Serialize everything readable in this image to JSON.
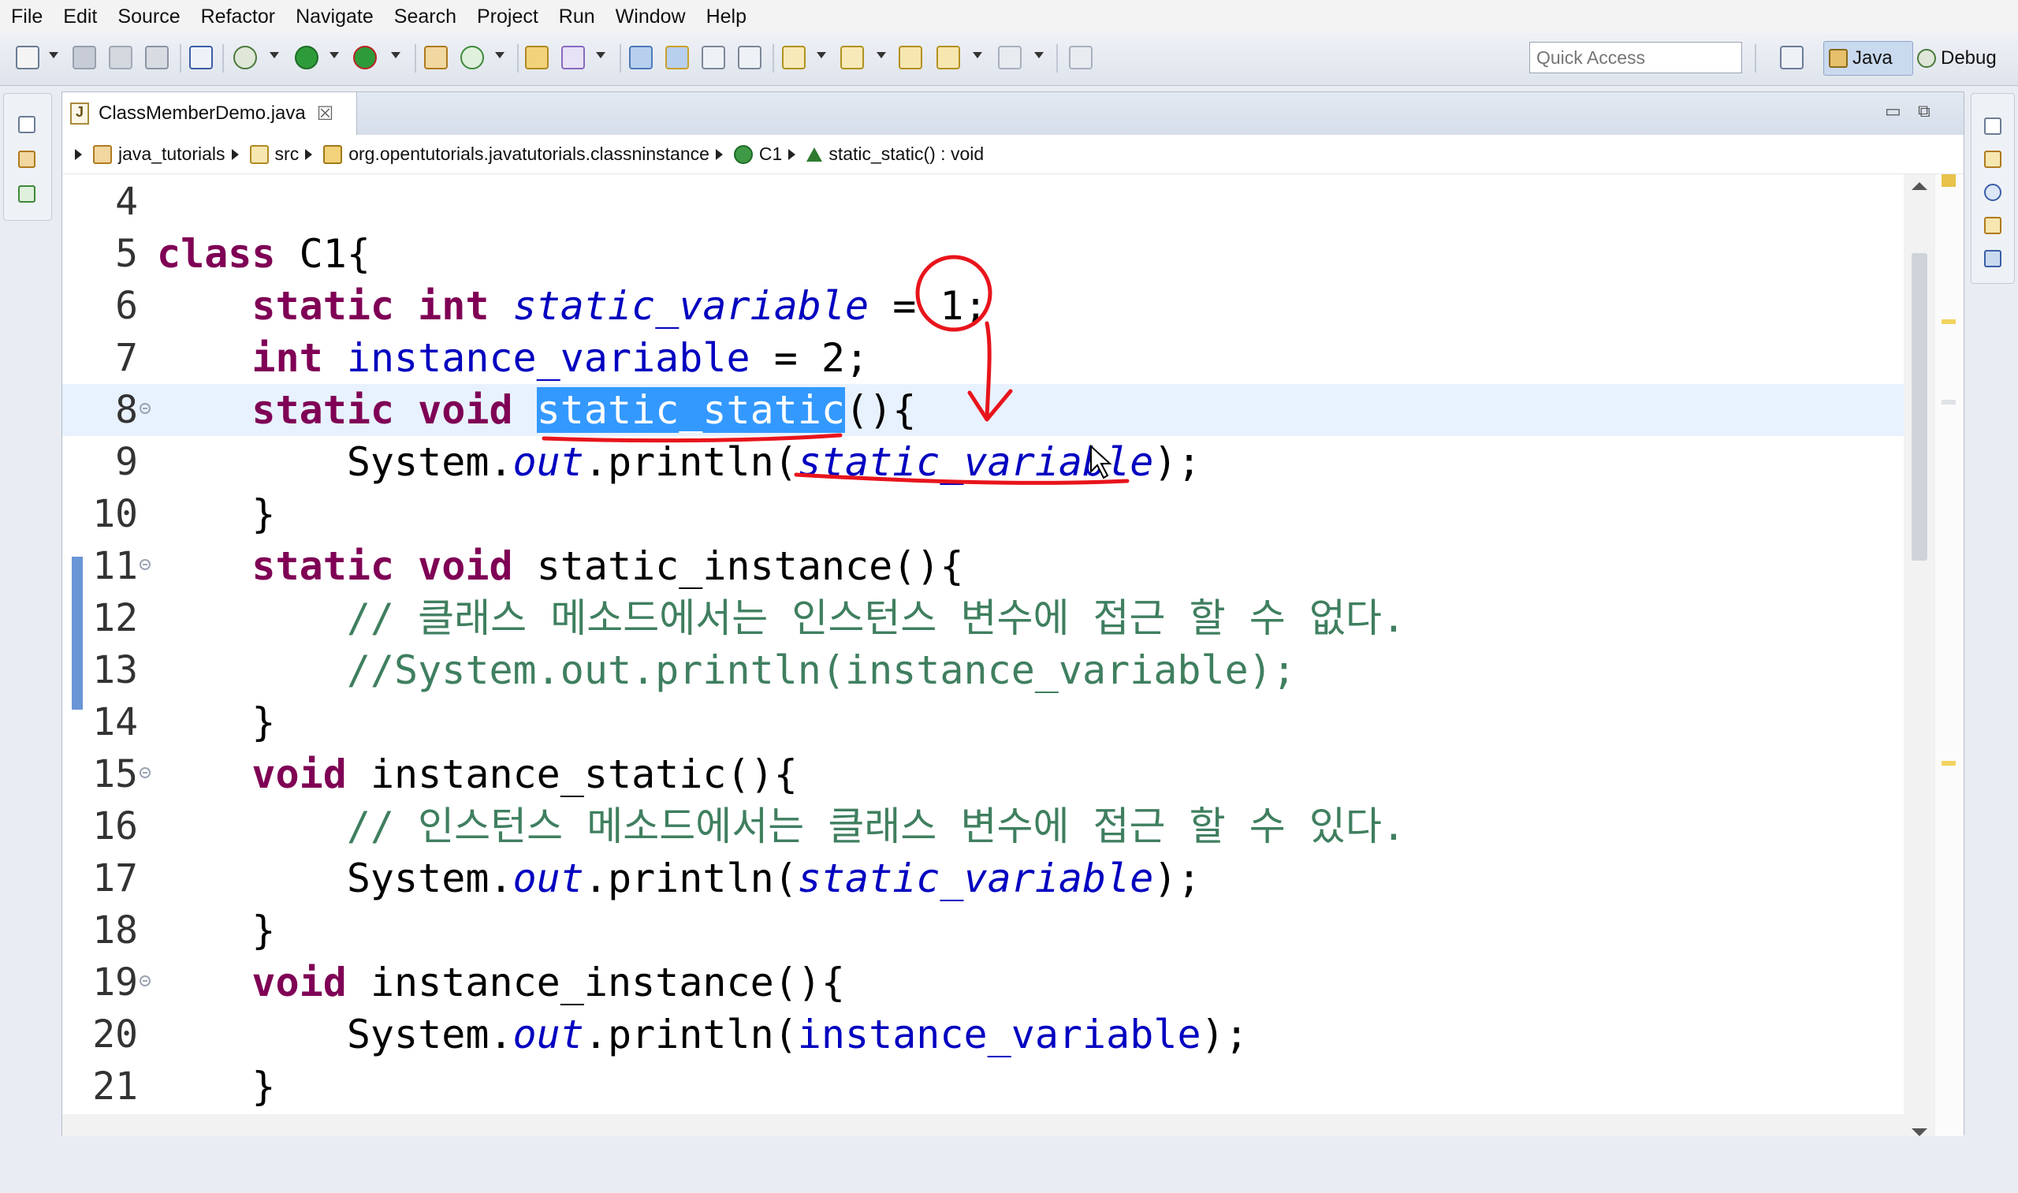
{
  "menu": [
    "File",
    "Edit",
    "Source",
    "Refactor",
    "Navigate",
    "Search",
    "Project",
    "Run",
    "Window",
    "Help"
  ],
  "toolbar": {
    "quick_access_placeholder": "Quick Access",
    "perspectives": [
      "Java",
      "Debug"
    ]
  },
  "editor": {
    "tab_label": "ClassMemberDemo.java",
    "tab_close": "☒",
    "breadcrumb": [
      "java_tutorials",
      "src",
      "org.opentutorials.javatutorials.classninstance",
      "C1",
      "static_static() : void"
    ]
  },
  "code": {
    "line_numbers": [
      "4",
      "5",
      "6",
      "7",
      "8",
      "9",
      "10",
      "11",
      "12",
      "13",
      "14",
      "15",
      "16",
      "17",
      "18",
      "19",
      "20",
      "21"
    ],
    "current_line": "8",
    "lines": [
      "",
      "class C1{",
      "    static int static_variable = 1;",
      "    int instance_variable = 2;",
      "    static void static_static(){",
      "        System.out.println(static_variable);",
      "    }",
      "    static void static_instance(){",
      "        // 클래스 메소드에서는 인스턴스 변수에 접근 할 수 없다.",
      "        //System.out.println(instance_variable);",
      "    }",
      "    void instance_static(){",
      "        // 인스턴스 메소드에서는 클래스 변수에 접근 할 수 있다.",
      "        System.out.println(static_variable);",
      "    }",
      "    void instance_instance(){",
      "        System.out.println(instance_variable);",
      "    }"
    ],
    "tokens": {
      "class": "class",
      "c1": "C1",
      "static": "static",
      "int": "int",
      "void": "void",
      "static_variable": "static_variable",
      "instance_variable": "instance_variable",
      "static_static": "static_static",
      "static_instance": "static_instance",
      "instance_static": "instance_static",
      "instance_instance": "instance_instance",
      "system": "System.",
      "out": "out",
      "println": ".println(",
      "comment12": "// 클래스 메소드에서는 인스턴스 변수에 접근 할 수 없다.",
      "comment13": "//System.out.println(instance_variable);",
      "comment16": "// 인스턴스 메소드에서는 클래스 변수에 접근 할 수 있다."
    }
  },
  "colors": {
    "keyword": "#7f0055",
    "field": "#0000c0",
    "comment": "#3f7f5f",
    "selection": "#3399ff",
    "annotation": "#e8141c"
  }
}
